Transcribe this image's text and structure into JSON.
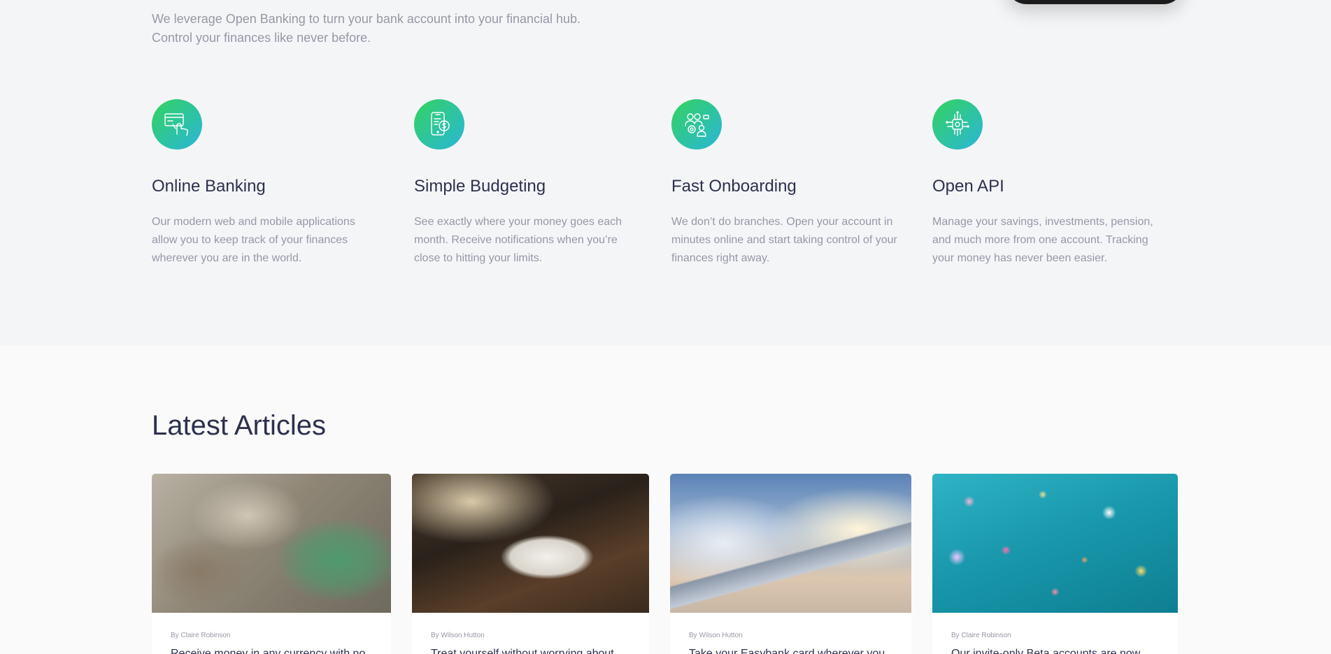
{
  "intro": {
    "line1": "We leverage Open Banking to turn your bank account into your financial hub.",
    "line2": "Control your finances like never before."
  },
  "features": [
    {
      "icon": "online-banking-icon",
      "title": "Online Banking",
      "description": "Our modern web and mobile applications allow you to keep track of your finances wherever you are in the world."
    },
    {
      "icon": "budgeting-icon",
      "title": "Simple Budgeting",
      "description": "See exactly where your money goes each month. Receive notifications when you’re close to hitting your limits."
    },
    {
      "icon": "onboarding-icon",
      "title": "Fast Onboarding",
      "description": "We don’t do branches. Open your account in minutes online and start taking control of your finances right away."
    },
    {
      "icon": "api-icon",
      "title": "Open API",
      "description": "Manage your savings, investments, pension, and much more from one account. Tracking your money has never been easier."
    }
  ],
  "articles": {
    "heading": "Latest Articles",
    "items": [
      {
        "author": "By Claire Robinson",
        "title": "Receive money in any currency with no"
      },
      {
        "author": "By Wilson Hutton",
        "title": "Treat yourself without worrying about"
      },
      {
        "author": "By Wilson Hutton",
        "title": "Take your Easybank card wherever you"
      },
      {
        "author": "By Claire Robinson",
        "title": "Our invite-only Beta accounts are now"
      }
    ]
  },
  "colors": {
    "heading": "#2d314d",
    "body_text": "#9698a6",
    "gradient_start": "#33d35e",
    "gradient_end": "#2ab6d9",
    "section_bg": "#f4f5f7",
    "page_bg": "#fafafa"
  }
}
